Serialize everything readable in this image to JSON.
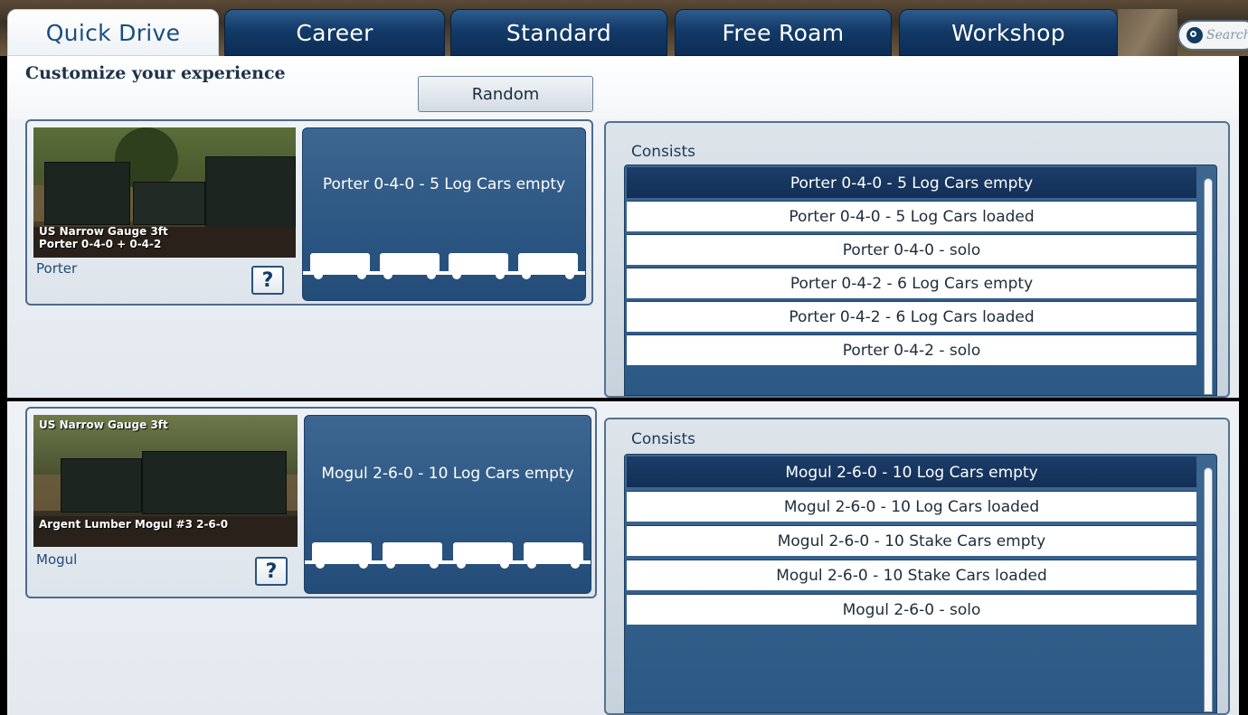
{
  "tabs": [
    {
      "label": "Quick Drive",
      "active": true
    },
    {
      "label": "Career"
    },
    {
      "label": "Standard"
    },
    {
      "label": "Free Roam"
    },
    {
      "label": "Workshop"
    }
  ],
  "search": {
    "placeholder": "Search"
  },
  "header": {
    "title": "Customize your experience",
    "random_label": "Random"
  },
  "sections": [
    {
      "thumb_caption_line1": "US Narrow Gauge 3ft",
      "thumb_caption_line2": "Porter 0-4-0 + 0-4-2",
      "loco_name": "Porter",
      "help_label": "?",
      "consist_title": "Porter 0-4-0 - 5 Log Cars empty",
      "consists_label": "Consists",
      "items": [
        "Porter 0-4-0 - 5 Log Cars empty",
        "Porter 0-4-0 - 5 Log Cars loaded",
        "Porter 0-4-0 - solo",
        "Porter 0-4-2 - 6 Log Cars empty",
        "Porter 0-4-2 - 6 Log Cars loaded",
        "Porter 0-4-2 - solo"
      ],
      "selected_index": 0
    },
    {
      "thumb_caption_line1": "US Narrow Gauge 3ft",
      "thumb_caption_line2": "Argent Lumber Mogul  #3    2-6-0",
      "loco_name": "Mogul",
      "help_label": "?",
      "consist_title": "Mogul 2-6-0 - 10 Log Cars empty",
      "consists_label": "Consists",
      "items": [
        "Mogul 2-6-0 - 10 Log Cars empty",
        "Mogul 2-6-0 - 10 Log Cars loaded",
        "Mogul 2-6-0 - 10 Stake Cars empty",
        "Mogul 2-6-0 - 10 Stake Cars loaded",
        "Mogul 2-6-0 - solo"
      ],
      "selected_index": 0
    }
  ],
  "colors": {
    "tab_blue": "#133a68",
    "active_tab_text": "#1a4d7e",
    "list_selected": "#132f56",
    "preview_blue": "#2c5683"
  }
}
